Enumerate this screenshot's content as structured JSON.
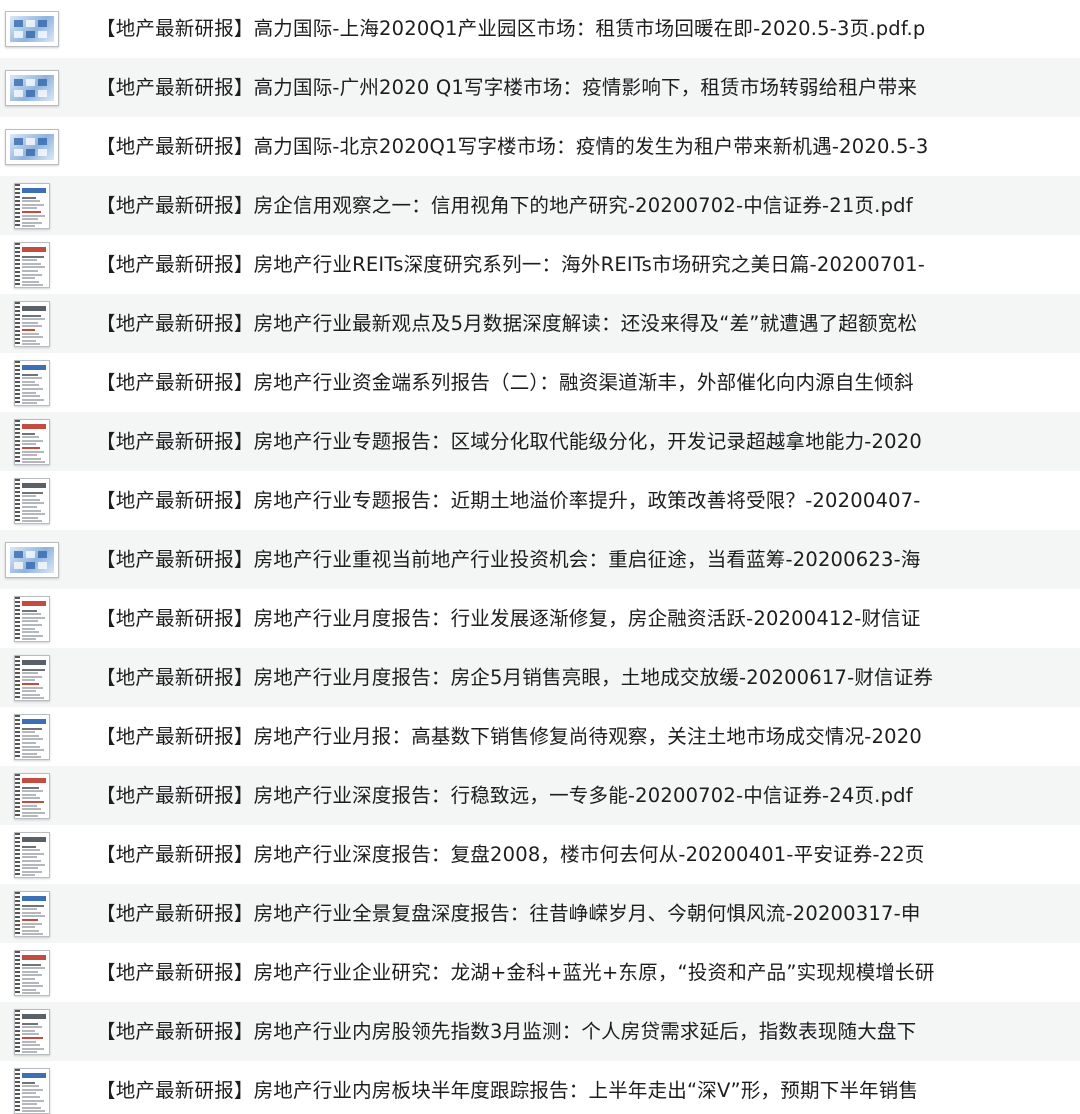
{
  "files": [
    {
      "name": "【地产最新研报】高力国际-上海2020Q1产业园区市场：租赁市场回暖在即-2020.5-3页.pdf.p",
      "thumb": "landscape"
    },
    {
      "name": "【地产最新研报】高力国际-广州2020 Q1写字楼市场：疫情影响下，租赁市场转弱给租户带来",
      "thumb": "landscape"
    },
    {
      "name": "【地产最新研报】高力国际-北京2020Q1写字楼市场：疫情的发生为租户带来新机遇-2020.5-3",
      "thumb": "landscape"
    },
    {
      "name": "【地产最新研报】房企信用观察之一：信用视角下的地产研究-20200702-中信证券-21页.pdf",
      "thumb": "portrait"
    },
    {
      "name": "【地产最新研报】房地产行业REITs深度研究系列一：海外REITs市场研究之美日篇-20200701-",
      "thumb": "portrait"
    },
    {
      "name": "【地产最新研报】房地产行业最新观点及5月数据深度解读：还没来得及“差”就遭遇了超额宽松",
      "thumb": "portrait"
    },
    {
      "name": "【地产最新研报】房地产行业资金端系列报告（二）：融资渠道渐丰，外部催化向内源自生倾斜",
      "thumb": "portrait"
    },
    {
      "name": "【地产最新研报】房地产行业专题报告：区域分化取代能级分化，开发记录超越拿地能力-2020",
      "thumb": "portrait"
    },
    {
      "name": "【地产最新研报】房地产行业专题报告：近期土地溢价率提升，政策改善将受限？-20200407-",
      "thumb": "portrait"
    },
    {
      "name": "【地产最新研报】房地产行业重视当前地产行业投资机会：重启征途，当看蓝筹-20200623-海",
      "thumb": "landscape"
    },
    {
      "name": "【地产最新研报】房地产行业月度报告：行业发展逐渐修复，房企融资活跃-20200412-财信证",
      "thumb": "portrait"
    },
    {
      "name": "【地产最新研报】房地产行业月度报告：房企5月销售亮眼，土地成交放缓-20200617-财信证券",
      "thumb": "portrait"
    },
    {
      "name": "【地产最新研报】房地产行业月报：高基数下销售修复尚待观察，关注土地市场成交情况-2020",
      "thumb": "portrait"
    },
    {
      "name": "【地产最新研报】房地产行业深度报告：行稳致远，一专多能-20200702-中信证券-24页.pdf",
      "thumb": "portrait"
    },
    {
      "name": "【地产最新研报】房地产行业深度报告：复盘2008，楼市何去何从-20200401-平安证券-22页",
      "thumb": "portrait"
    },
    {
      "name": "【地产最新研报】房地产行业全景复盘深度报告：往昔峥嵘岁月、今朝何惧风流-20200317-申",
      "thumb": "portrait"
    },
    {
      "name": "【地产最新研报】房地产行业企业研究：龙湖+金科+蓝光+东原，“投资和产品”实现规模增长研",
      "thumb": "portrait"
    },
    {
      "name": "【地产最新研报】房地产行业内房股领先指数3月监测：个人房贷需求延后，指数表现随大盘下",
      "thumb": "portrait"
    },
    {
      "name": "【地产最新研报】房地产行业内房板块半年度跟踪报告：上半年走出“深V”形，预期下半年销售",
      "thumb": "portrait"
    }
  ]
}
